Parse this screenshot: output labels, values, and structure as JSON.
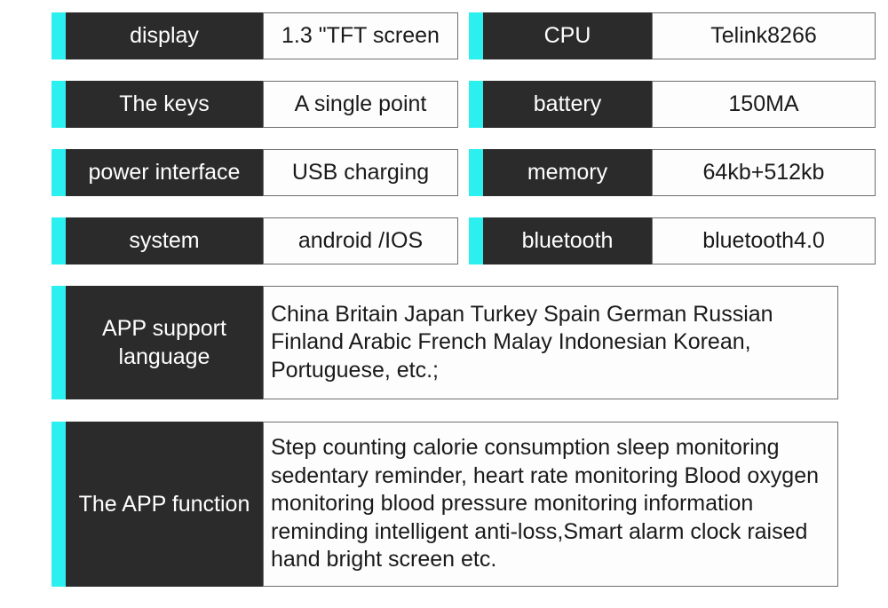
{
  "accent_color": "#2CF0F0",
  "label_bg_color": "#2B2B2B",
  "value_bg_color": "#FDFDFD",
  "spec_table": {
    "left_column": [
      {
        "label": "display",
        "value": "1.3 \"TFT screen"
      },
      {
        "label": "The keys",
        "value": "A single point"
      },
      {
        "label": "power interface",
        "value": "USB charging"
      },
      {
        "label": "system",
        "value": "android /IOS"
      }
    ],
    "right_column": [
      {
        "label": "CPU",
        "value": "Telink8266"
      },
      {
        "label": "battery",
        "value": "150MA"
      },
      {
        "label": "memory",
        "value": "64kb+512kb"
      },
      {
        "label": "bluetooth",
        "value": "bluetooth4.0"
      }
    ],
    "wide_rows": [
      {
        "label": "APP support language",
        "value": "China Britain Japan Turkey Spain German Russian Finland Arabic French Malay Indonesian Korean, Portuguese, etc.;"
      },
      {
        "label": "The APP function",
        "value": "Step counting calorie consumption sleep monitoring sedentary reminder, heart rate monitoring Blood oxygen monitoring blood pressure monitoring information reminding intelligent anti-loss,Smart alarm clock raised hand bright screen etc."
      }
    ]
  }
}
